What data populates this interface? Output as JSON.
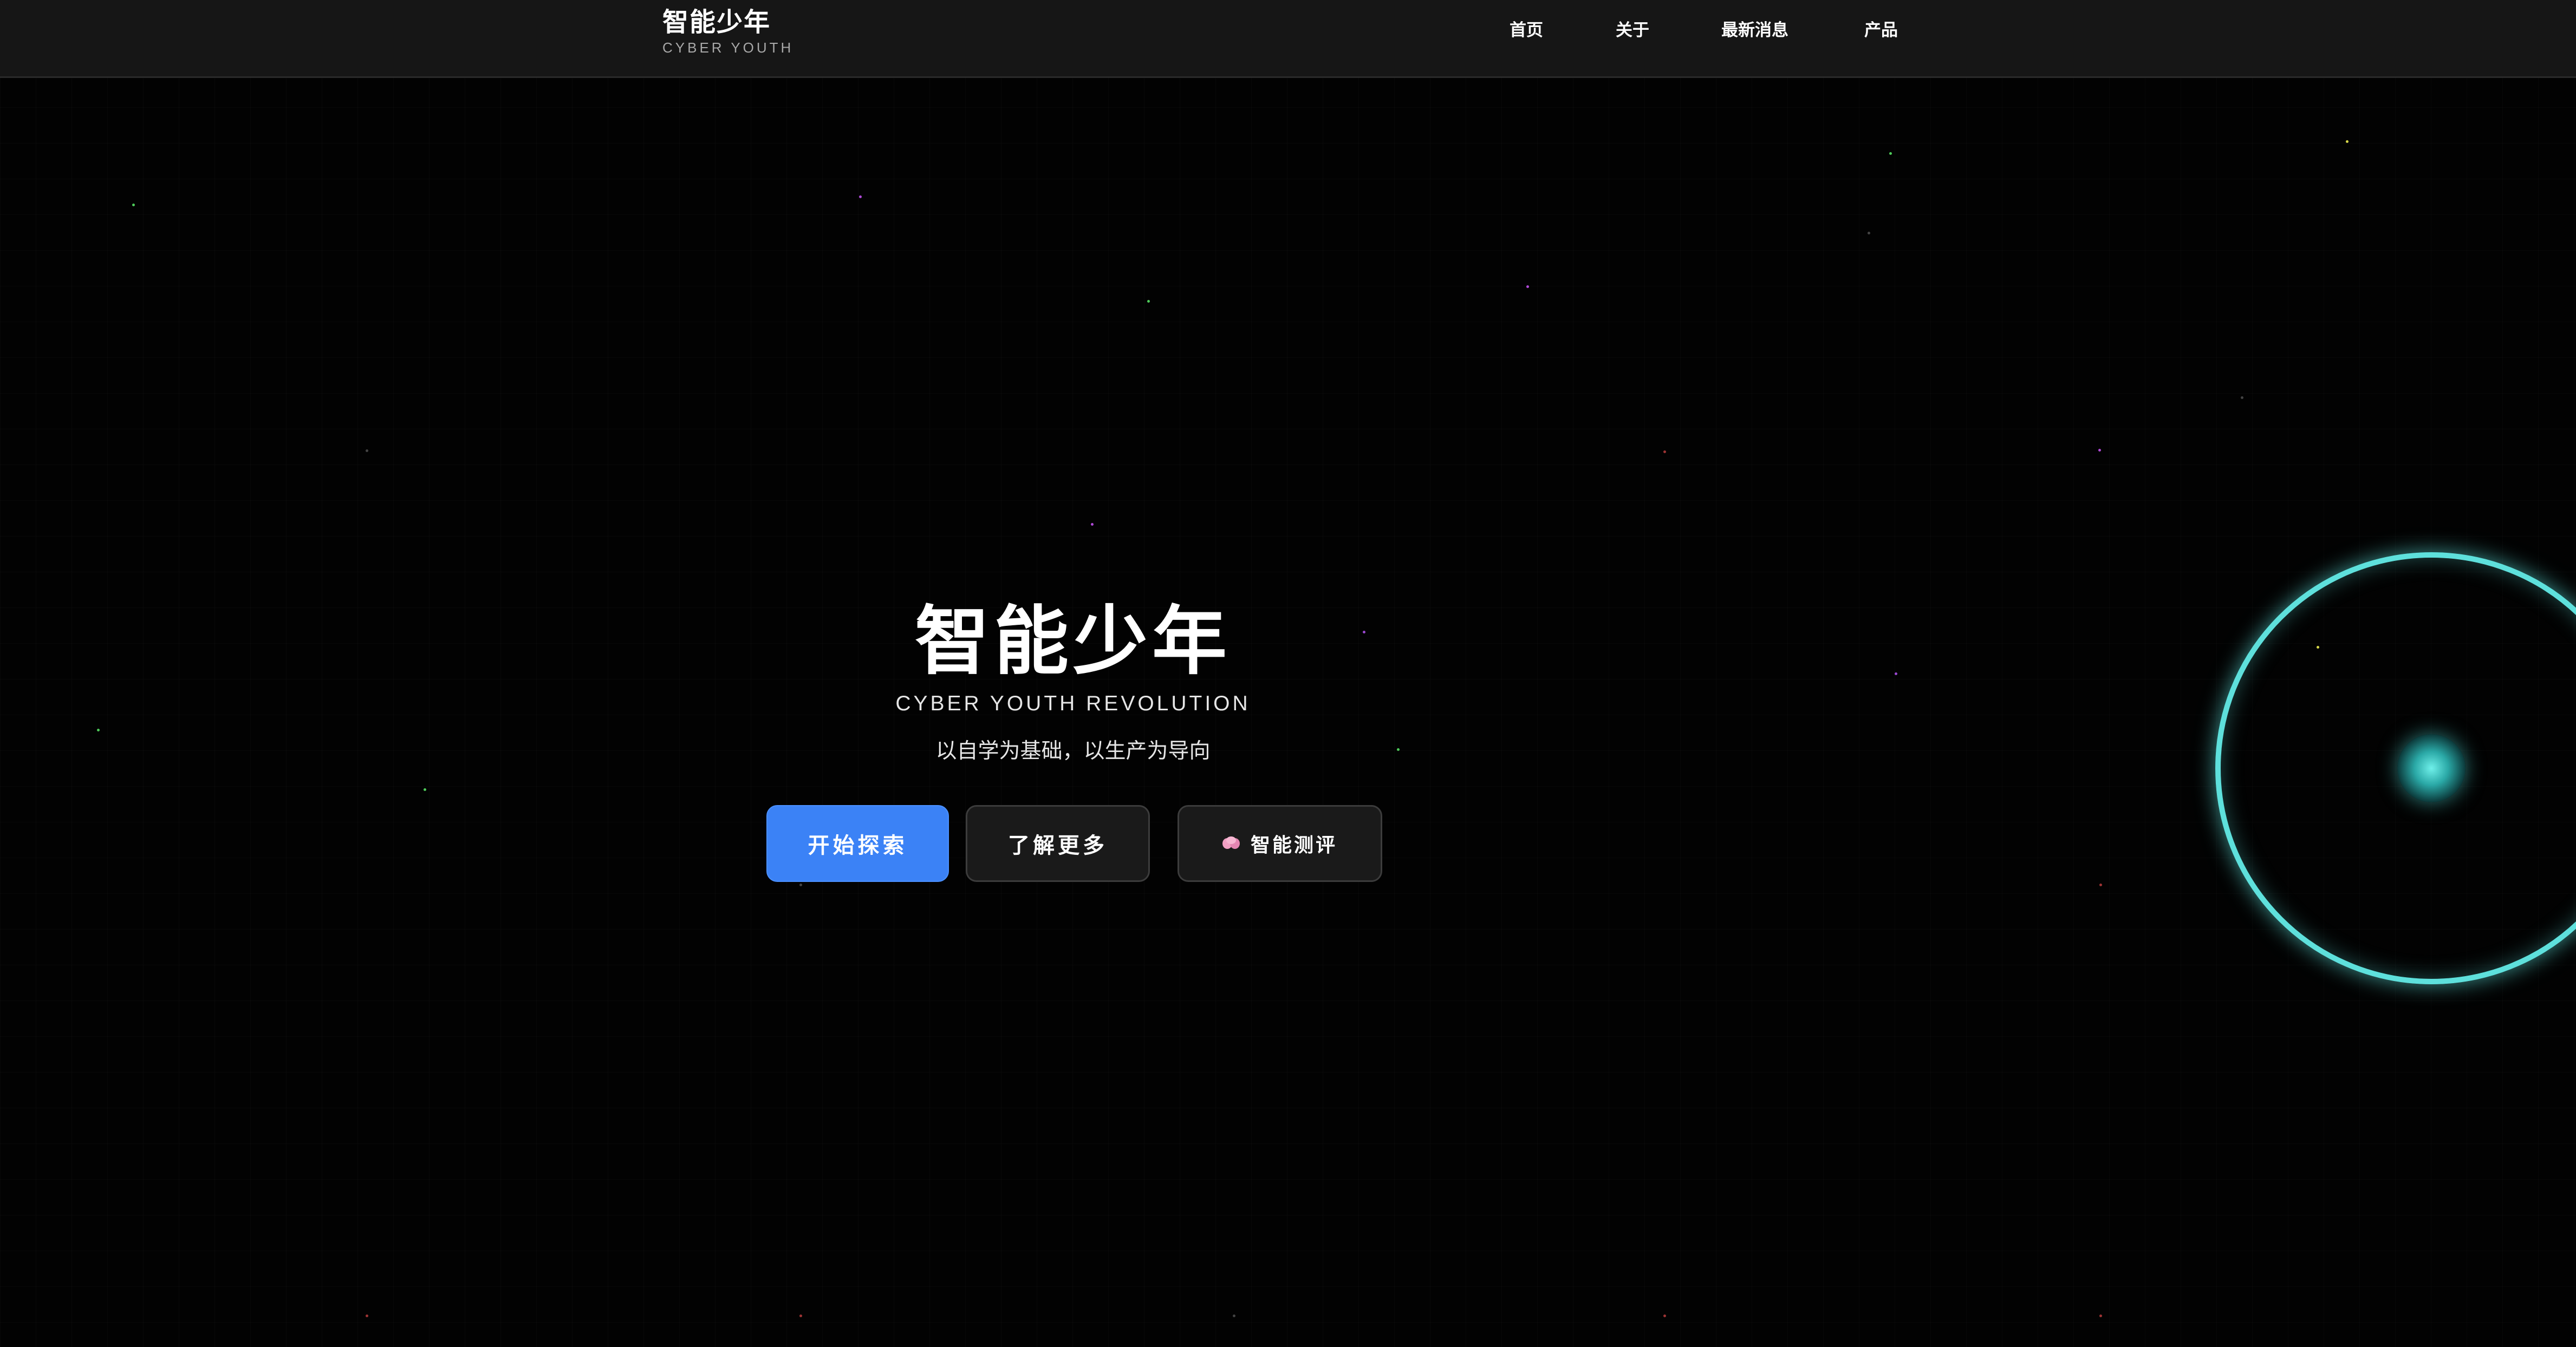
{
  "header": {
    "brand_title": "智能少年",
    "brand_subtitle": "CYBER YOUTH",
    "nav": [
      {
        "label": "首页"
      },
      {
        "label": "关于"
      },
      {
        "label": "最新消息"
      },
      {
        "label": "产品"
      }
    ]
  },
  "hero": {
    "title": "智能少年",
    "subtitle": "CYBER YOUTH REVOLUTION",
    "tagline": "以自学为基础，以生产为导向",
    "buttons": {
      "explore": "开始探索",
      "learn_more": "了解更多",
      "assessment": "智能测评",
      "assessment_icon": "brain-icon"
    }
  },
  "decor": {
    "orb_icon": "glowing-ring-icon",
    "colors": {
      "background": "#020202",
      "nav_background": "#161616",
      "primary": "#3b82f6",
      "orb": "#5ee0dc"
    }
  }
}
